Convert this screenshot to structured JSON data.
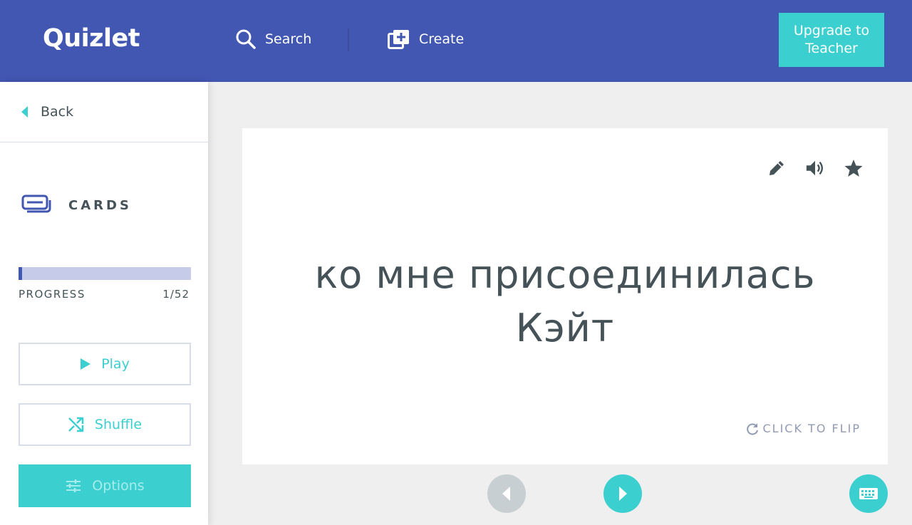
{
  "header": {
    "logo": "Quizlet",
    "nav": {
      "search_label": "Search",
      "create_label": "Create"
    },
    "upgrade_label": "Upgrade to Teacher"
  },
  "sidebar": {
    "back_label": "Back",
    "mode_label": "CARDS",
    "progress": {
      "label": "PROGRESS",
      "current": 1,
      "total": 52,
      "count_text": "1/52"
    },
    "buttons": {
      "play_label": "Play",
      "shuffle_label": "Shuffle",
      "options_label": "Options"
    }
  },
  "card": {
    "term": "ко мне присоединилась Кэйт",
    "flip_hint": "CLICK TO FLIP",
    "icons": [
      "edit-icon",
      "audio-icon",
      "star-icon"
    ]
  },
  "colors": {
    "brand_blue": "#4257b2",
    "accent_teal": "#3ccfcf",
    "text": "#455358",
    "muted": "#939bb4",
    "progress_track": "#c6cbe9"
  }
}
